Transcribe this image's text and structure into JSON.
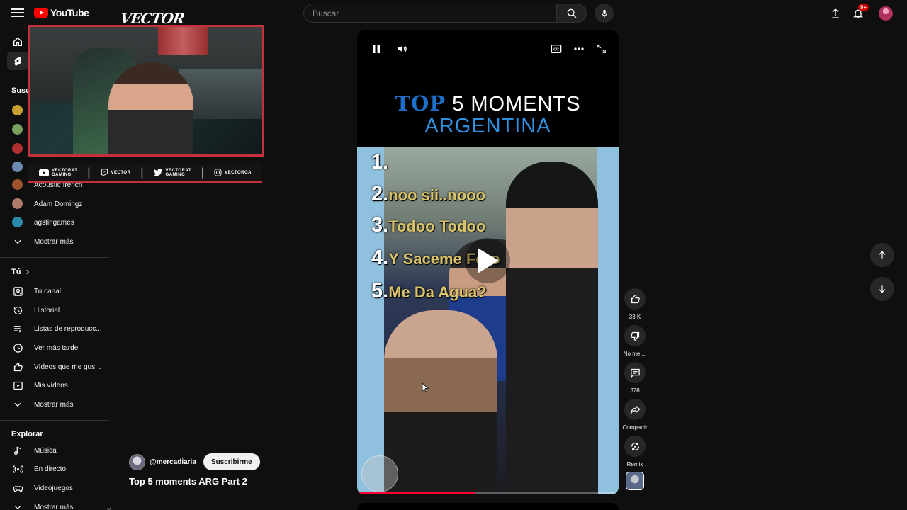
{
  "topbar": {
    "logo_text": "YouTube",
    "search_placeholder": "Buscar",
    "notifications_badge": "9+"
  },
  "overlay": {
    "logo": "VECTOR",
    "socials": [
      {
        "icon": "youtube-icon",
        "line1": "VECTORAT",
        "line2": "GAMING"
      },
      {
        "icon": "twitch-icon",
        "line1": "VECTOR",
        "line2": ""
      },
      {
        "icon": "twitter-icon",
        "line1": "VECTORAT",
        "line2": "GAMING"
      },
      {
        "icon": "instagram-icon",
        "line1": "VECTORGA",
        "line2": ""
      }
    ]
  },
  "sidebar": {
    "subs_title": "Susc",
    "subscriptions": [
      {
        "label": "Acoustic french",
        "color": "#a0522d"
      },
      {
        "label": "Adam Domingz",
        "color": "#b07a6a"
      },
      {
        "label": "agstingames",
        "color": "#2a8aa8"
      }
    ],
    "subs_more": "Mostrar más",
    "you_title": "Tú",
    "you_items": [
      {
        "label": "Tu canal",
        "icon": "channel-icon"
      },
      {
        "label": "Historial",
        "icon": "history-icon"
      },
      {
        "label": "Listas de reproducc...",
        "icon": "playlists-icon"
      },
      {
        "label": "Ver más tarde",
        "icon": "watch-later-icon"
      },
      {
        "label": "Vídeos que me gus...",
        "icon": "liked-icon"
      },
      {
        "label": "Mis vídeos",
        "icon": "my-videos-icon"
      }
    ],
    "you_more": "Mostrar más",
    "explore_title": "Explorar",
    "explore_items": [
      {
        "label": "Música",
        "icon": "music-icon"
      },
      {
        "label": "En directo",
        "icon": "live-icon"
      },
      {
        "label": "Videojuegos",
        "icon": "gaming-icon"
      },
      {
        "label": "Mostrar más",
        "icon": "chevron-down-icon"
      }
    ]
  },
  "short": {
    "title_top": "TOP",
    "title_rest": " 5 MOMENTS",
    "title_line2": "ARGENTINA",
    "list": [
      {
        "num": "1.",
        "text": ""
      },
      {
        "num": "2.",
        "text": "noo sii..nooo"
      },
      {
        "num": "3.",
        "text": "Todoo Todoo"
      },
      {
        "num": "4.",
        "text": "Y Saceme Foto"
      },
      {
        "num": "5.",
        "text": "Me Da Agua?"
      }
    ],
    "progress": 0.45,
    "channel_handle": "@mercadiaria",
    "subscribe_label": "Suscribirme",
    "video_title": "Top 5 moments ARG Part 2"
  },
  "actions": {
    "like_count": "33 K",
    "dislike_label": "No me ...",
    "comments_count": "378",
    "share_label": "Compartir",
    "remix_label": "Remix"
  }
}
